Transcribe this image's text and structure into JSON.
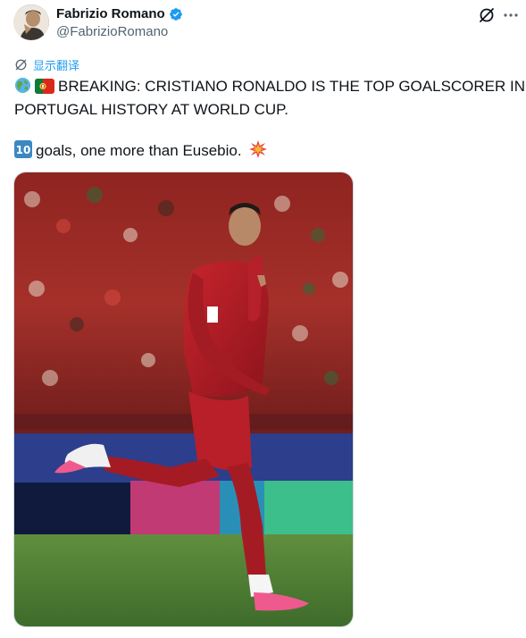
{
  "author": {
    "name": "Fabrizio Romano",
    "handle": "@FabrizioRomano",
    "verified": true
  },
  "translate": {
    "label": "显示翻译",
    "icon": "globe-translate-icon"
  },
  "tweet": {
    "line1": "BREAKING: CRISTIANO RONALDO IS THE TOP GOALSCORER IN",
    "line2": "PORTUGAL HISTORY AT WORLD CUP.",
    "line3": "goals, one more than Eusebio."
  },
  "icons": {
    "globe": "globe-emoji-icon",
    "flag": "portugal-flag-icon",
    "keycap": "keycap-10-icon",
    "collision": "collision-emoji-icon",
    "grok": "grok-icon",
    "more": "more-icon"
  },
  "colors": {
    "accent": "#1d9bf0",
    "text": "#0f1419",
    "secondary": "#536471"
  }
}
